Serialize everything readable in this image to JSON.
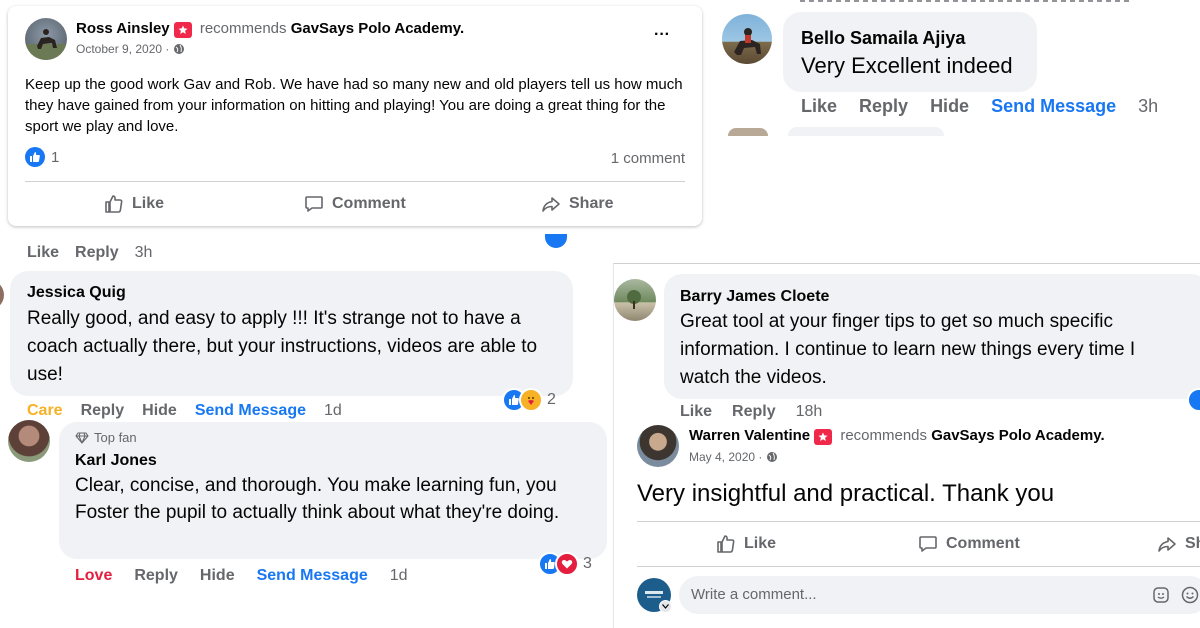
{
  "post1": {
    "author": "Ross Ainsley",
    "recommends": "recommends",
    "page": "GavSays Polo Academy.",
    "date": "October 9, 2020 ·",
    "more": "···",
    "body": "Keep up the good work Gav and Rob. We have had so many new and old players tell us how much they have gained from your information on hitting and playing! You are doing a great thing for the sport we play and love.",
    "reaction_count": "1",
    "comment_count": "1 comment",
    "like_label": "Like",
    "comment_label": "Comment",
    "share_label": "Share"
  },
  "bello": {
    "name": "Bello Samaila Ajiya",
    "text": "Very Excellent indeed",
    "actions": [
      "Like",
      "Reply",
      "Hide",
      "Send Message",
      "3h"
    ]
  },
  "jessica": {
    "prev_actions": [
      "Like",
      "Reply",
      "3h"
    ],
    "name": "Jessica Quig",
    "text": "Really good, and easy to apply !!! It's strange not to have a coach actually there, but your instructions, videos are able to use!",
    "reaction_count": "2",
    "actions": [
      "Care",
      "Reply",
      "Hide",
      "Send Message",
      "1d"
    ]
  },
  "karl": {
    "badge": "Top fan",
    "name": "Karl Jones",
    "text": "Clear, concise, and thorough. You make learning fun, you Foster the pupil to actually think about what they're doing.",
    "reaction_count": "3",
    "actions": [
      "Love",
      "Reply",
      "Hide",
      "Send Message",
      "1d"
    ]
  },
  "barry": {
    "name": "Barry James Cloete",
    "text": "Great tool at your finger tips to get so much specific information. I continue to learn new things every time I watch the videos.",
    "actions": [
      "Like",
      "Reply",
      "18h"
    ]
  },
  "post2": {
    "author": "Warren Valentine",
    "recommends": "recommends",
    "page": "GavSays Polo Academy.",
    "date": "May 4, 2020 ·",
    "body": "Very insightful and practical. Thank you",
    "like_label": "Like",
    "comment_label": "Comment",
    "share_label": "Sh",
    "write_placeholder": "Write a comment..."
  },
  "colors": {
    "facebook_blue": "#1877f2",
    "bubble_gray": "#f0f2f5",
    "text_gray": "#65676b",
    "recommend_red": "#f02849",
    "care_orange": "#f7b125",
    "love_red": "#e41e3f"
  }
}
